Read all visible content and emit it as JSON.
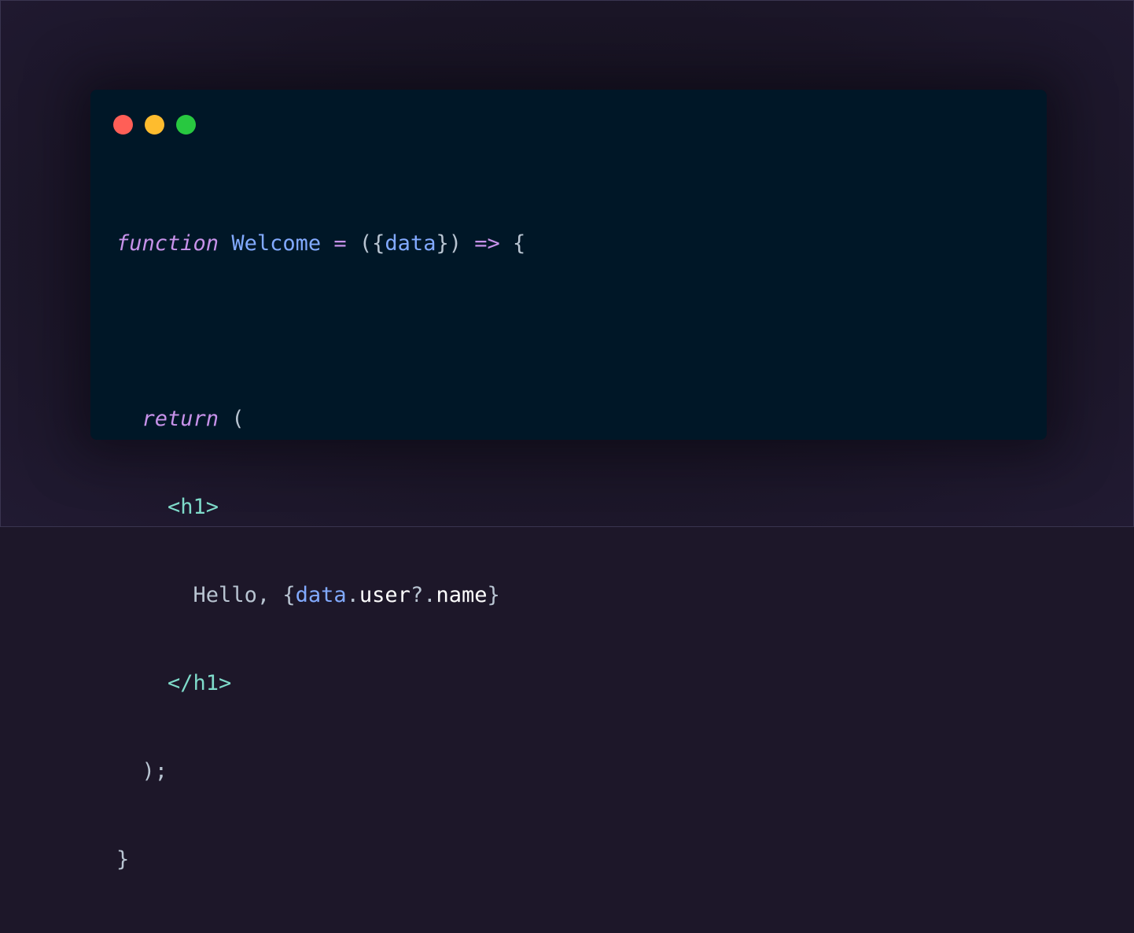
{
  "window": {
    "controls": [
      {
        "name": "close",
        "color": "#ff5f57"
      },
      {
        "name": "minimize",
        "color": "#febc2e"
      },
      {
        "name": "maximize",
        "color": "#28c840"
      }
    ]
  },
  "code": {
    "line1": {
      "keyword": "function",
      "name": "Welcome",
      "equals": "=",
      "open": "({",
      "param": "data",
      "close": "})",
      "arrow": "=>",
      "brace": "{"
    },
    "line3": {
      "keyword": "return",
      "paren": "("
    },
    "line4": {
      "tag": "<h1>"
    },
    "line5": {
      "text": "Hello, ",
      "open": "{",
      "obj": "data",
      "dot": ".",
      "prop1": "user",
      "optional": "?.",
      "prop2": "name",
      "close": "}"
    },
    "line6": {
      "tag": "</h1>"
    },
    "line7": {
      "text": ");"
    },
    "line8": {
      "text": "}"
    }
  }
}
